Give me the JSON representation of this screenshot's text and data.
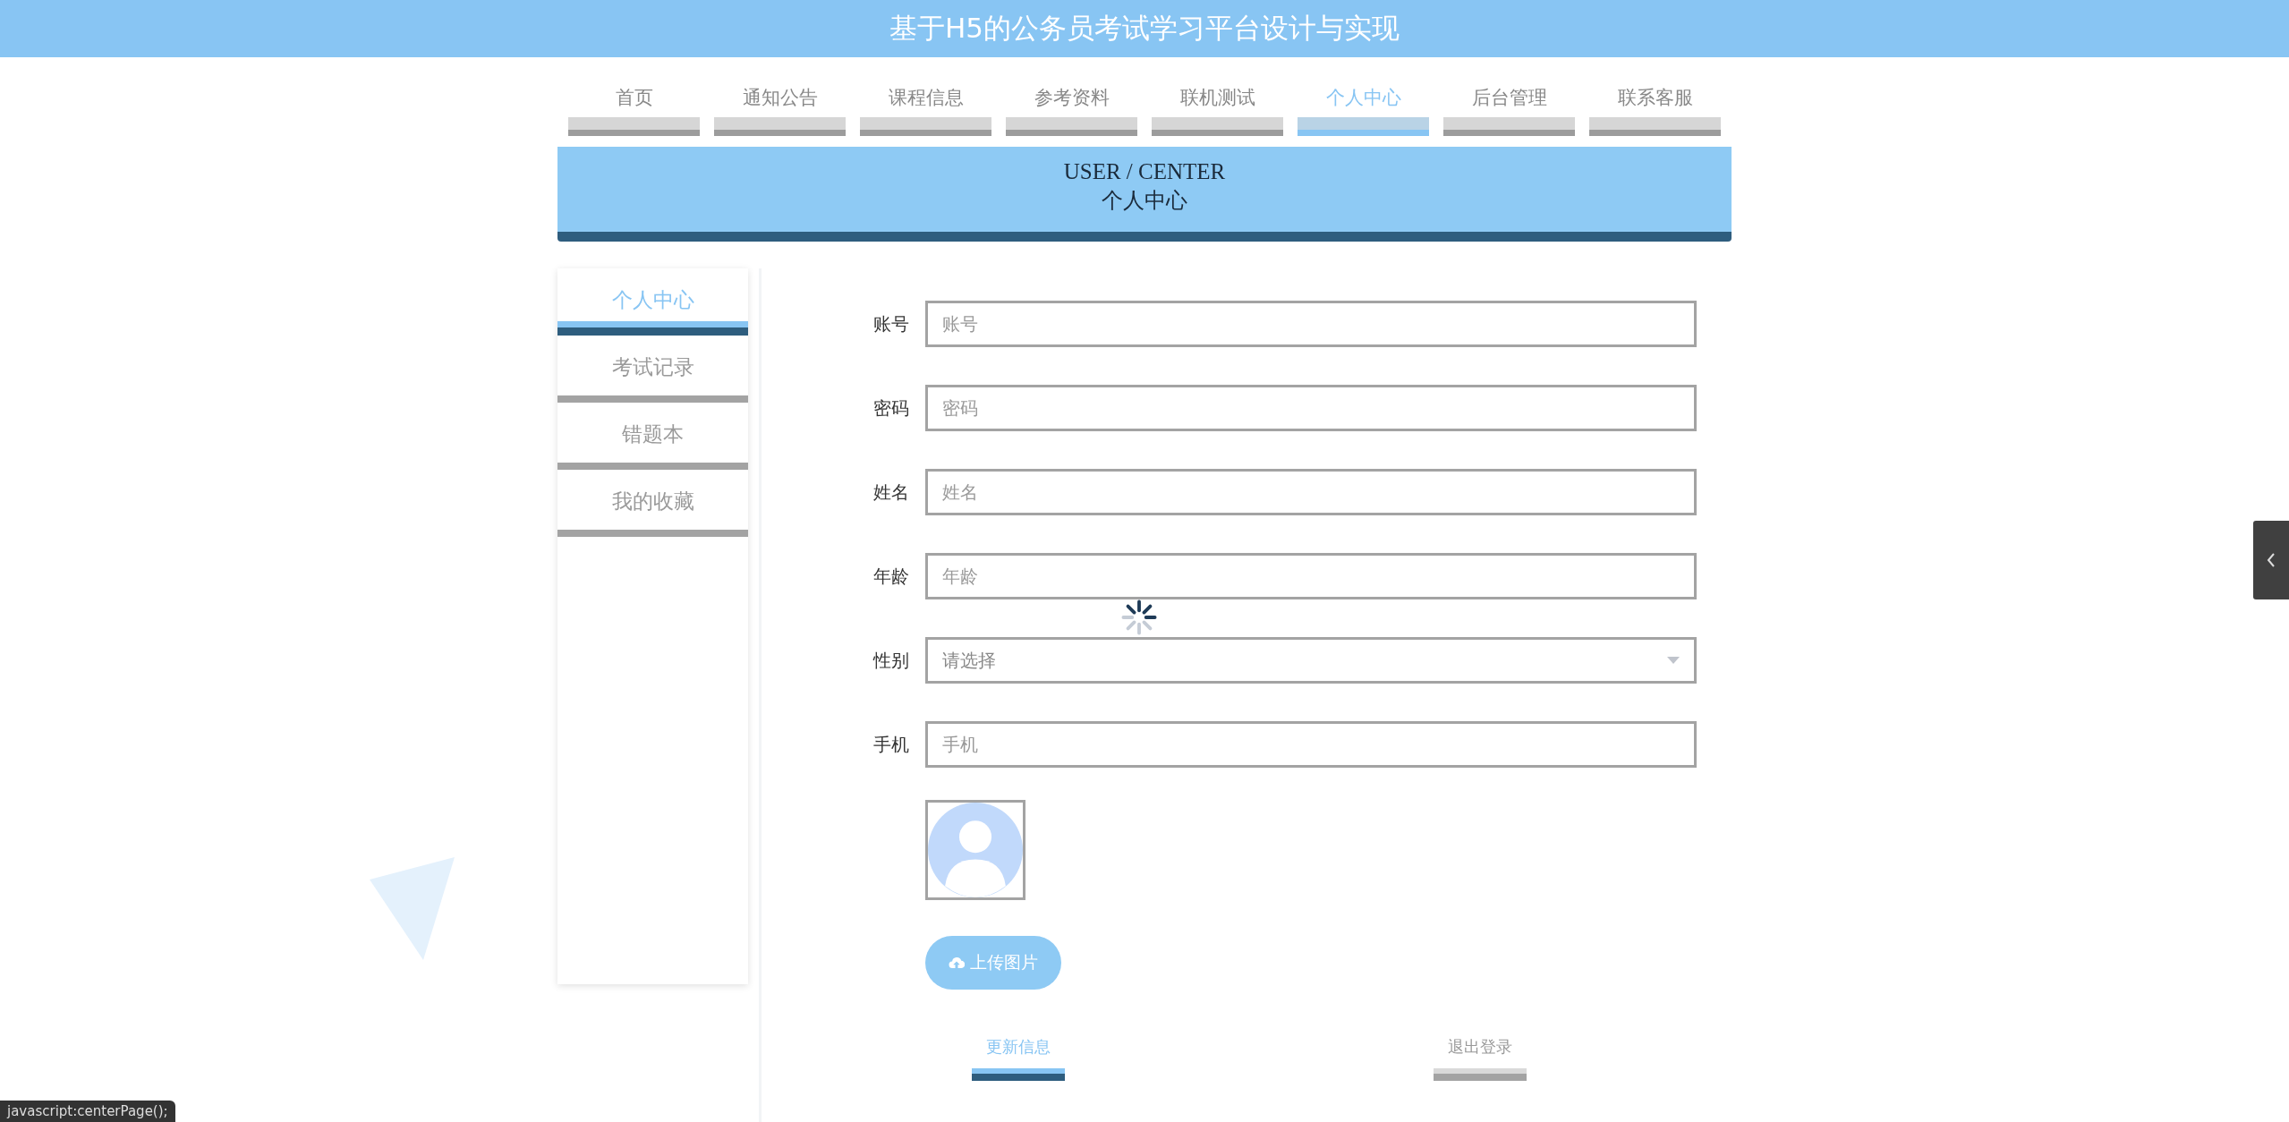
{
  "header": {
    "title": "基于H5的公务员考试学习平台设计与实现"
  },
  "nav": [
    {
      "label": "首页",
      "selected": false
    },
    {
      "label": "通知公告",
      "selected": false
    },
    {
      "label": "课程信息",
      "selected": false
    },
    {
      "label": "参考资料",
      "selected": false
    },
    {
      "label": "联机测试",
      "selected": false
    },
    {
      "label": "个人中心",
      "selected": true
    },
    {
      "label": "后台管理",
      "selected": false
    },
    {
      "label": "联系客服",
      "selected": false
    }
  ],
  "banner": {
    "subtitle_en": "USER / CENTER",
    "title": "个人中心"
  },
  "sidebar": [
    {
      "label": "个人中心",
      "selected": true
    },
    {
      "label": "考试记录",
      "selected": false
    },
    {
      "label": "错题本",
      "selected": false
    },
    {
      "label": "我的收藏",
      "selected": false
    }
  ],
  "form": {
    "fields": [
      {
        "label": "账号",
        "placeholder": "账号",
        "kind": "text"
      },
      {
        "label": "密码",
        "placeholder": "密码",
        "kind": "text"
      },
      {
        "label": "姓名",
        "placeholder": "姓名",
        "kind": "text"
      },
      {
        "label": "年龄",
        "placeholder": "年龄",
        "kind": "text"
      },
      {
        "label": "性别",
        "placeholder": "请选择",
        "kind": "select"
      },
      {
        "label": "手机",
        "placeholder": "手机",
        "kind": "text"
      }
    ],
    "upload_button": "上传图片",
    "actions": [
      {
        "label": "更新信息",
        "kind": "primary"
      },
      {
        "label": "退出登录",
        "kind": "secondary"
      }
    ]
  },
  "status_bar": "javascript:centerPage();"
}
